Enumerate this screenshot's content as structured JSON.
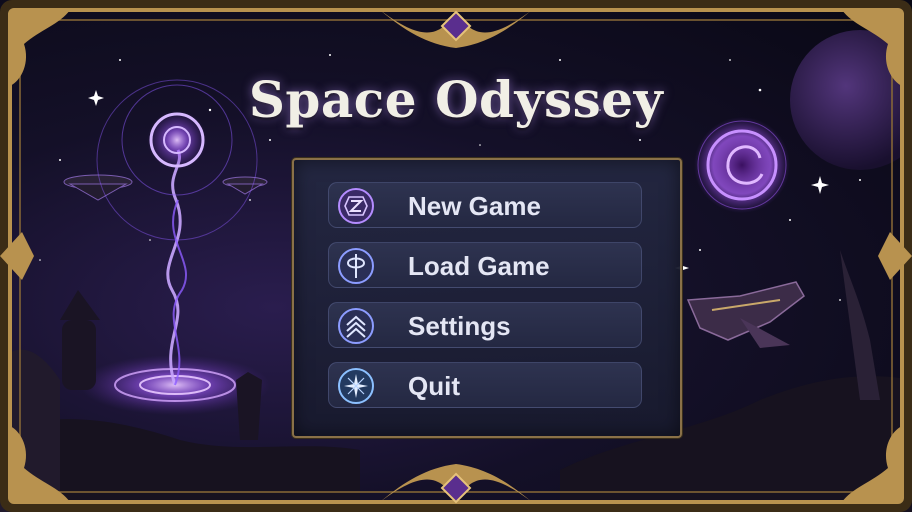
{
  "game": {
    "title": "Space Odyssey"
  },
  "menu": {
    "items": [
      {
        "label": "New Game",
        "icon": "z-rune-icon"
      },
      {
        "label": "Load Game",
        "icon": "phi-rune-icon"
      },
      {
        "label": "Settings",
        "icon": "chevrons-up-icon"
      },
      {
        "label": "Quit",
        "icon": "star-compass-icon"
      }
    ]
  },
  "colors": {
    "frame_gold": "#b8924f",
    "accent_purple": "#a774ff",
    "panel_bg": "#1f2238",
    "text": "#e4e6f4"
  }
}
